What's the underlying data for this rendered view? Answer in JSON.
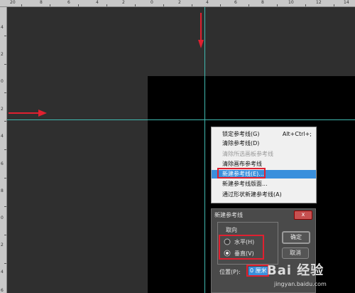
{
  "ruler": {
    "top_labels": [
      "20",
      "8",
      "6",
      "4",
      "2",
      "0",
      "2",
      "4",
      "6",
      "8",
      "10",
      "12",
      "14"
    ],
    "left_labels": [
      "4",
      "2",
      "0",
      "2",
      "4",
      "6",
      "8",
      "0",
      "2",
      "4",
      "6"
    ]
  },
  "colors": {
    "guide": "#3fb9b0",
    "highlight": "#3a8fdc",
    "annotation": "#e02030"
  },
  "context_menu": {
    "items": [
      {
        "label": "锁定参考线(G)",
        "shortcut": "Alt+Ctrl+;",
        "state": "normal"
      },
      {
        "label": "清除参考线(D)",
        "shortcut": "",
        "state": "normal"
      },
      {
        "label": "清除所选画板参考线",
        "shortcut": "",
        "state": "disabled"
      },
      {
        "label": "清除画布参考线",
        "shortcut": "",
        "state": "normal"
      },
      {
        "label": "新建参考线(E)...",
        "shortcut": "",
        "state": "highlighted"
      },
      {
        "label": "新建参考线版面...",
        "shortcut": "",
        "state": "normal"
      },
      {
        "label": "通过形状新建参考线(A)",
        "shortcut": "",
        "state": "normal"
      }
    ]
  },
  "dialog": {
    "title": "新建参考线",
    "close": "x",
    "orientation_label": "取向",
    "horizontal_label": "水平(H)",
    "vertical_label": "垂直(V)",
    "selected": "vertical",
    "ok_label": "确定",
    "cancel_label": "取消",
    "position_label": "位置(P):",
    "position_value": "0 厘米"
  },
  "watermark": {
    "brand": "Bai 经验",
    "url": "jingyan.baidu.com"
  }
}
